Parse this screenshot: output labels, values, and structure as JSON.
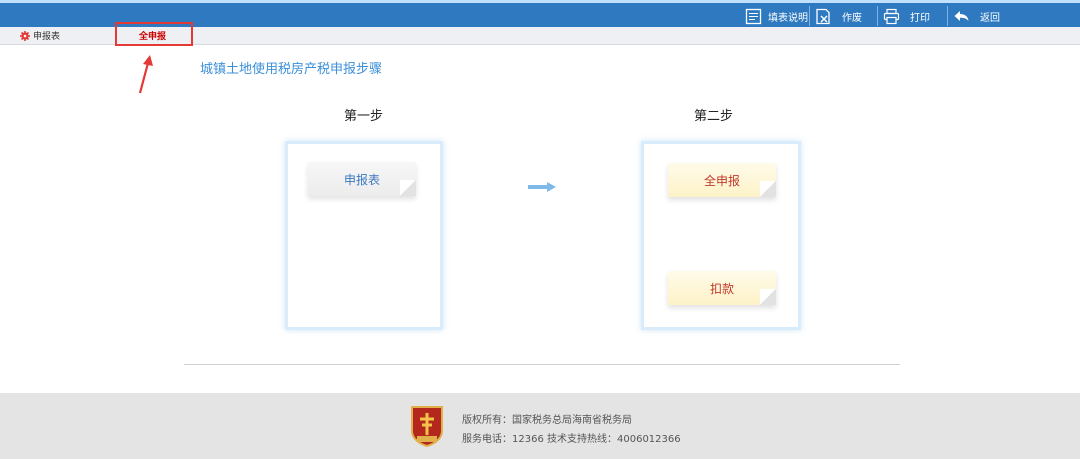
{
  "toolbar": {
    "fill_help": "填表说明",
    "void": "作废",
    "print": "打印",
    "back": "返回"
  },
  "tabs": {
    "report_form": "申报表",
    "full_report": "全申报"
  },
  "main": {
    "heading": "城镇土地使用税房产税申报步骤",
    "step1": {
      "title": "第一步",
      "button": "申报表"
    },
    "step2": {
      "title": "第二步",
      "button_full": "全申报",
      "button_deduct": "扣款"
    }
  },
  "footer": {
    "copyright": "版权所有：国家税务总局海南省税务局",
    "service": "服务电话：12366  技术支持热线：4006012366",
    "logo_text": "税徽"
  },
  "colors": {
    "toolbar_bg": "#2e79c0",
    "highlight": "#e53935",
    "heading": "#3b8fd8"
  }
}
